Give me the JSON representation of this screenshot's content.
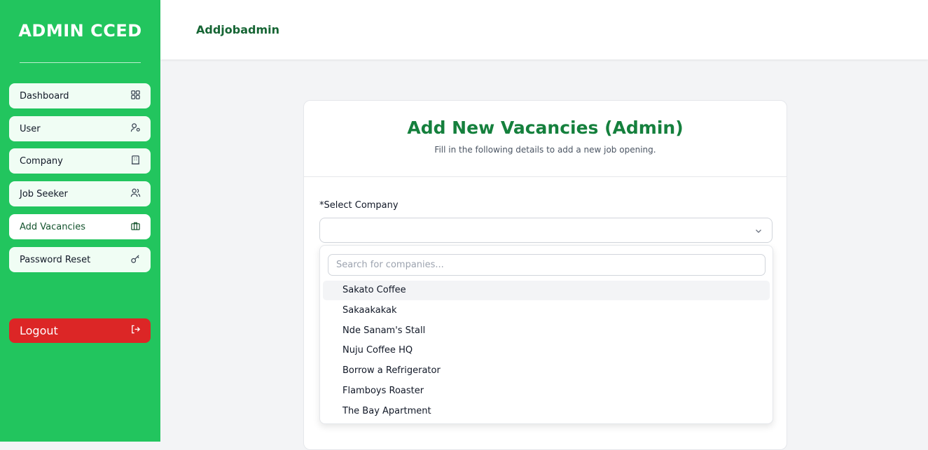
{
  "sidebar": {
    "brand": "ADMIN CCED",
    "items": [
      {
        "label": "Dashboard",
        "icon": "grid-icon"
      },
      {
        "label": "User",
        "icon": "user-settings-icon"
      },
      {
        "label": "Company",
        "icon": "building-icon"
      },
      {
        "label": "Job Seeker",
        "icon": "users-icon"
      },
      {
        "label": "Add Vacancies",
        "icon": "briefcase-icon",
        "active": true
      },
      {
        "label": "Password Reset",
        "icon": "key-icon"
      }
    ],
    "logout": {
      "label": "Logout",
      "icon": "logout-icon"
    }
  },
  "header": {
    "title": "Addjobadmin"
  },
  "form": {
    "title": "Add New Vacancies (Admin)",
    "subtitle": "Fill in the following details to add a new job opening.",
    "company_label": "*Select Company",
    "company_value": ""
  },
  "dropdown": {
    "search_placeholder": "Search for companies...",
    "options": [
      "Sakato Coffee",
      "Sakaakakak",
      "Nde Sanam's Stall",
      "Nuju Coffee HQ",
      "Borrow a Refrigerator",
      "Flamboys Roaster",
      "The Bay Apartment"
    ]
  },
  "colors": {
    "sidebar_bg": "#22c55e",
    "accent_dark": "#15803d",
    "logout_bg": "#dc2626"
  }
}
